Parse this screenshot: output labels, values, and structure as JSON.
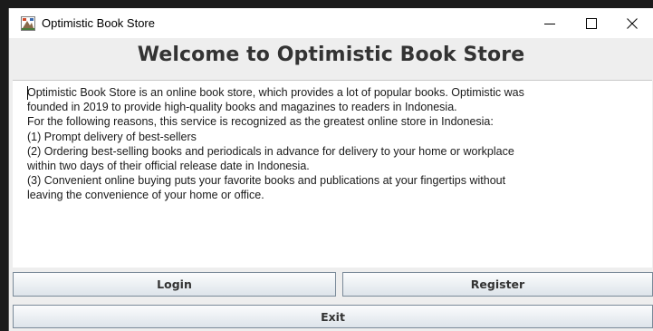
{
  "window": {
    "title": "Optimistic Book Store",
    "controls": {
      "minimize": "—",
      "maximize": "☐",
      "close": "✕"
    }
  },
  "main": {
    "heading": "Welcome to Optimistic Book Store",
    "description_lines": [
      "Optimistic Book Store is an online book store, which provides a lot of popular books. Optimistic was",
      "founded in 2019 to provide high-quality books and magazines to readers in Indonesia.",
      "For the following reasons, this service is recognized as the greatest online store in Indonesia:",
      "(1) Prompt delivery of best-sellers",
      "(2) Ordering best-selling books and periodicals in advance for delivery to your home or workplace",
      "within two days of their official release date in Indonesia.",
      "(3) Convenient online buying puts your favorite books and publications at your fingertips without",
      "leaving the convenience of your home or office."
    ]
  },
  "buttons": {
    "login": "Login",
    "register": "Register",
    "exit": "Exit"
  },
  "icons": {
    "app": "java-app-icon"
  }
}
